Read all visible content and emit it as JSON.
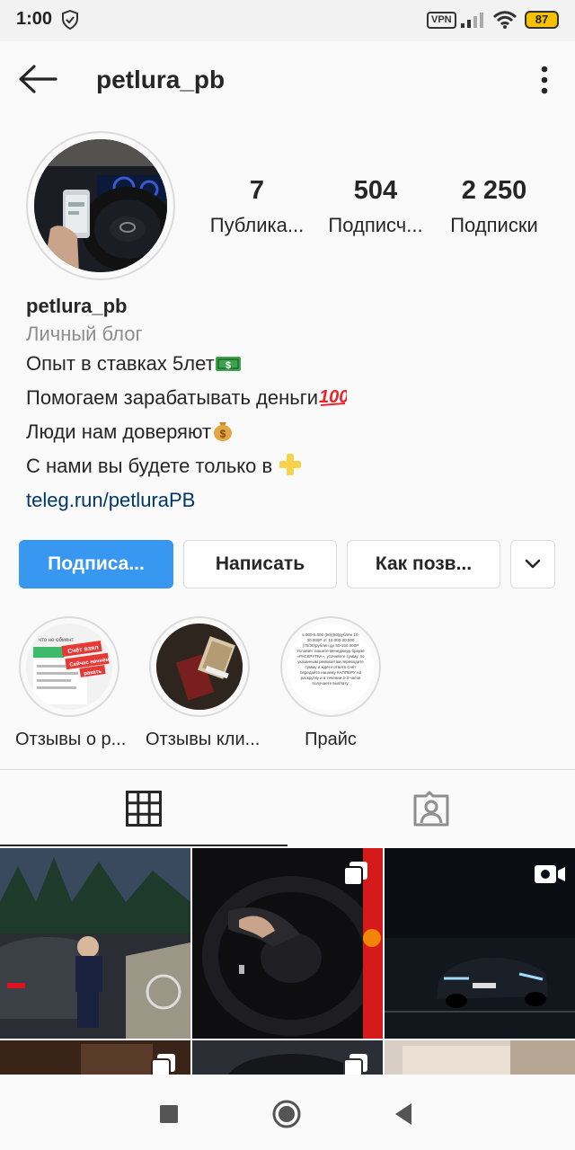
{
  "status_bar": {
    "time": "1:00",
    "vpn_label": "VPN",
    "battery": "87",
    "icons": [
      "shield-icon",
      "signal-icon",
      "wifi-icon",
      "battery-icon"
    ]
  },
  "header": {
    "username": "petlura_pb",
    "icons": [
      "back-arrow-icon",
      "more-vertical-icon"
    ]
  },
  "stats": [
    {
      "value": "7",
      "label": "Публика..."
    },
    {
      "value": "504",
      "label": "Подписч..."
    },
    {
      "value": "2 250",
      "label": "Подписки"
    }
  ],
  "bio": {
    "name": "petlura_pb",
    "category": "Личный блог",
    "lines": [
      "Опыт в ставках 5лет",
      "Помогаем зарабатывать деньги",
      "Люди нам доверяют",
      "С нами вы будете только в "
    ],
    "emojis": [
      "dollar-banknote-emoji",
      "hundred-points-emoji",
      "money-bag-emoji",
      "plus-emoji"
    ],
    "link": "teleg.run/petluraPB"
  },
  "buttons": {
    "follow": "Подписа...",
    "message": "Написать",
    "contact": "Как позв..."
  },
  "highlights": [
    {
      "label": "Отзывы о р..."
    },
    {
      "label": "Отзывы кли..."
    },
    {
      "label": "Прайс"
    }
  ],
  "highlight_thumb_text": {
    "h1_top": "что не обмент",
    "h1_banner1": "Счёт взял",
    "h1_banner2": "Сейчас начнём",
    "h1_banner3": "ракать",
    "h3_text": "5.000-5.000 (50)(50)рублен  10-30.000Р  от 10.000-30.000 (70/30)рублен до  50-150.000Р  Условия: пишите менеджеру браузе «РАСКРУТКА», уточняете сумму, по указанным реквизитам переводите сумму и ждёте ответа  Счёт передайте нашему КАППЕРУ на раскрутку и в течении 2-3 часов получаете выплату."
  },
  "grid": {
    "icons": [
      "multiple-posts-icon",
      "video-icon"
    ]
  },
  "colors": {
    "accent": "#3897f0",
    "link": "#00376b",
    "muted": "#8e8e8e",
    "border": "#dbdbdb"
  }
}
